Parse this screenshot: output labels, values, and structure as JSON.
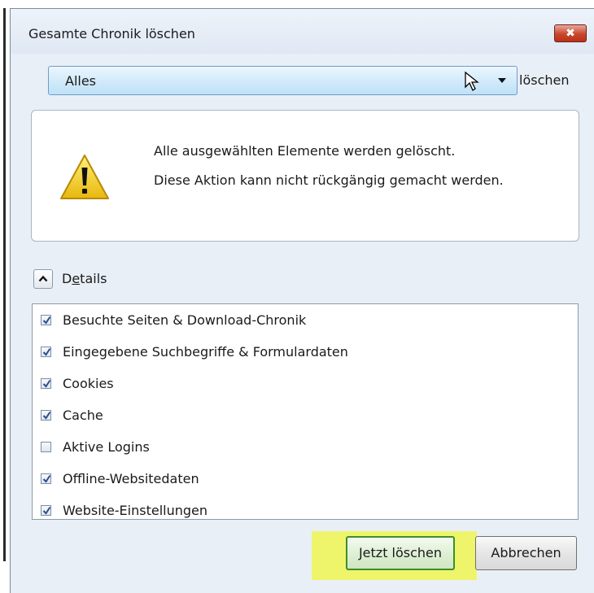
{
  "window": {
    "title": "Gesamte Chronik löschen",
    "close_icon": "close-icon",
    "close_label": "✖"
  },
  "range": {
    "selected": "Alles",
    "suffix_label": "löschen"
  },
  "warning": {
    "line1": "Alle ausgewählten Elemente werden gelöscht.",
    "line2": "Diese Aktion kann nicht rückgängig gemacht werden.",
    "icon": "warning-icon"
  },
  "details": {
    "label_prefix": "D",
    "label_mnemonic": "e",
    "label_suffix": "tails",
    "expanded": true
  },
  "items": [
    {
      "label": "Besuchte Seiten & Download-Chronik",
      "checked": true
    },
    {
      "label": "Eingegebene Suchbegriffe & Formulardaten",
      "checked": true
    },
    {
      "label": "Cookies",
      "checked": true
    },
    {
      "label": "Cache",
      "checked": true
    },
    {
      "label": "Aktive Logins",
      "checked": false
    },
    {
      "label": "Offline-Websitedaten",
      "checked": true
    },
    {
      "label": "Website-Einstellungen",
      "checked": true
    }
  ],
  "buttons": {
    "confirm": "Jetzt löschen",
    "cancel": "Abbrechen"
  },
  "colors": {
    "highlight": "#eef56a",
    "dialog_bg": "#e9eff7",
    "close_red": "#c9462c"
  }
}
